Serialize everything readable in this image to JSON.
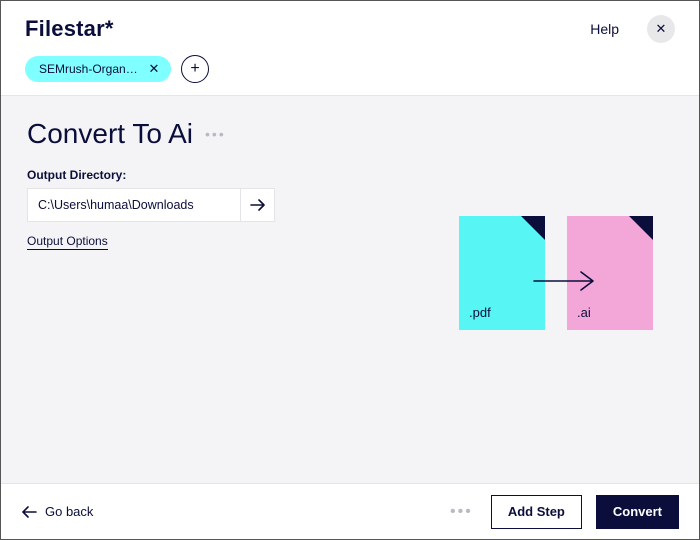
{
  "header": {
    "logo": "Filestar*",
    "help_label": "Help",
    "file_chip": "SEMrush-Organic…"
  },
  "main": {
    "title": "Convert To Ai",
    "output_dir_label": "Output Directory:",
    "output_dir_value": "C:\\Users\\humaa\\Downloads",
    "output_options_label": "Output Options",
    "src_ext": ".pdf",
    "dst_ext": ".ai"
  },
  "footer": {
    "go_back_label": "Go back",
    "add_step_label": "Add Step",
    "convert_label": "Convert"
  }
}
